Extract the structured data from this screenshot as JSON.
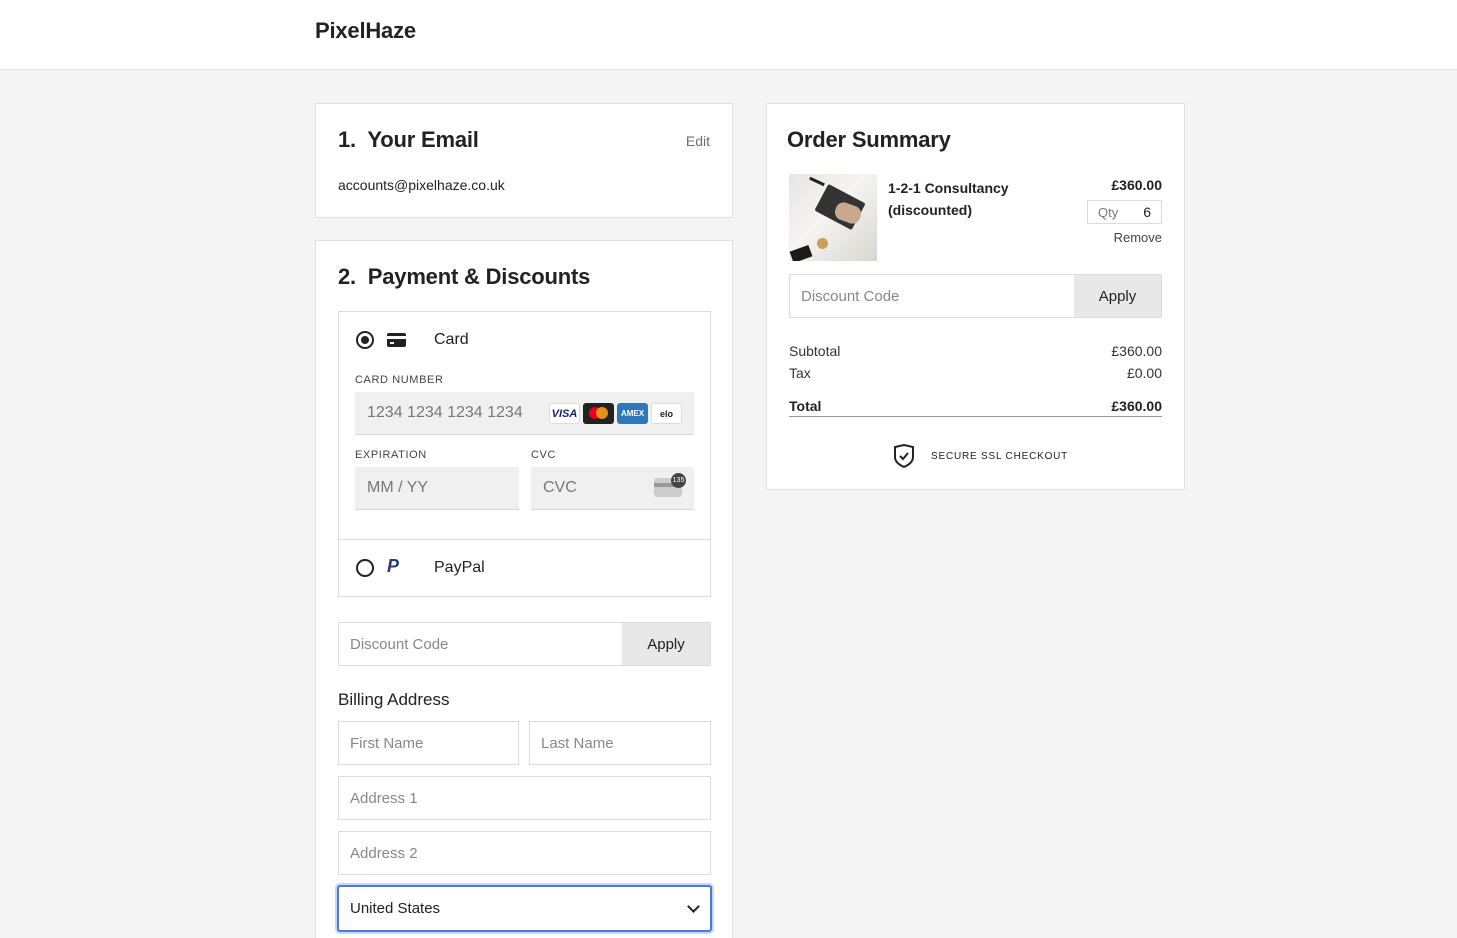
{
  "brand": {
    "name": "PixelHaze"
  },
  "email_section": {
    "number": "1.",
    "title": "Your Email",
    "edit_label": "Edit",
    "email": "accounts@pixelhaze.co.uk"
  },
  "payment_section": {
    "number": "2.",
    "title": "Payment & Discounts",
    "card_method": {
      "label": "Card",
      "selected": true,
      "card_number_label": "CARD NUMBER",
      "card_number_placeholder": "1234 1234 1234 1234",
      "brands": [
        "VISA",
        "mastercard",
        "AMEX",
        "elo"
      ],
      "expiration_label": "EXPIRATION",
      "expiration_placeholder": "MM / YY",
      "cvc_label": "CVC",
      "cvc_placeholder": "CVC",
      "cvc_icon_text": "135"
    },
    "paypal_method": {
      "label": "PayPal",
      "selected": false
    },
    "discount": {
      "placeholder": "Discount Code",
      "apply_label": "Apply"
    },
    "billing": {
      "title": "Billing Address",
      "first_name_placeholder": "First Name",
      "last_name_placeholder": "Last Name",
      "address1_placeholder": "Address 1",
      "address2_placeholder": "Address 2",
      "country": "United States"
    }
  },
  "order_summary": {
    "title": "Order Summary",
    "item": {
      "name": "1-2-1 Consultancy (discounted)",
      "price": "£360.00",
      "qty_label": "Qty",
      "qty": "6",
      "remove_label": "Remove"
    },
    "discount": {
      "placeholder": "Discount Code",
      "apply_label": "Apply"
    },
    "subtotal_label": "Subtotal",
    "subtotal": "£360.00",
    "tax_label": "Tax",
    "tax": "£0.00",
    "total_label": "Total",
    "total": "£360.00",
    "secure_label": "SECURE SSL CHECKOUT"
  },
  "colors": {
    "focus": "#4a7bd9",
    "background": "#f4f4f4"
  },
  "icons": [
    "card-icon",
    "paypal-icon",
    "cvc-card-icon",
    "chevron-down-icon",
    "shield-check-icon"
  ]
}
